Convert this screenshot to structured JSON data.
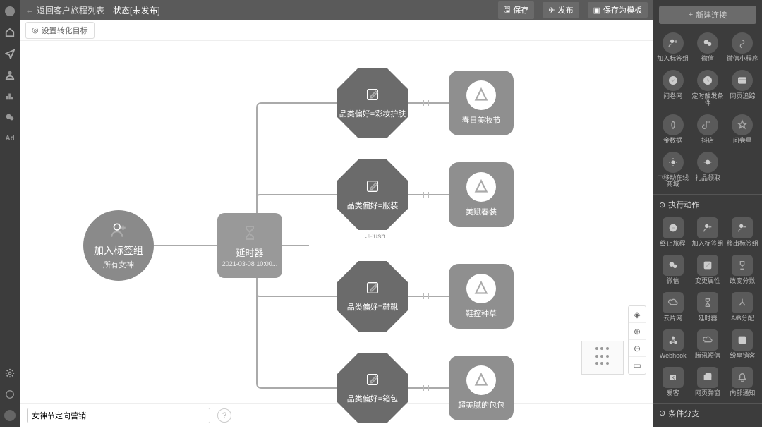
{
  "leftRail": [
    "home",
    "send",
    "user",
    "chart",
    "chat",
    "ad"
  ],
  "topbar": {
    "back": "返回客户旅程列表",
    "status": "状态[未发布]",
    "save": "保存",
    "publish": "发布",
    "saveTpl": "保存为模板"
  },
  "subbar": {
    "goal": "设置转化目标"
  },
  "canvas": {
    "start": {
      "title": "加入标签组",
      "sub": "所有女神"
    },
    "delay": {
      "title": "延时器",
      "sub": "2021-03-08 10:00..."
    },
    "branches": [
      {
        "cond": "品类偏好=彩妆护肤",
        "out": "春日美妆节"
      },
      {
        "cond": "品类偏好=服装",
        "out": "美赋春装",
        "caption": "JPush"
      },
      {
        "cond": "品类偏好=鞋靴",
        "out": "鞋控种草"
      },
      {
        "cond": "品类偏好=箱包",
        "out": "超美腻的包包"
      }
    ]
  },
  "bottom": {
    "name": "女神节定向营销"
  },
  "panel": {
    "newBtn": "新建连接",
    "row1": [
      {
        "l": "加入标签组"
      },
      {
        "l": "微信"
      },
      {
        "l": "微信小程序"
      }
    ],
    "row2": [
      {
        "l": "问卷网"
      },
      {
        "l": "定时触发条件"
      },
      {
        "l": "网页追踪"
      }
    ],
    "row3": [
      {
        "l": "金数据"
      },
      {
        "l": "抖店"
      },
      {
        "l": "问卷星"
      }
    ],
    "row4": [
      {
        "l": "中移动在线商城"
      },
      {
        "l": "礼品领取"
      }
    ],
    "sec2": "执行动作",
    "row5": [
      {
        "l": "终止旅程"
      },
      {
        "l": "加入标签组"
      },
      {
        "l": "移出标签组"
      }
    ],
    "row6": [
      {
        "l": "微信"
      },
      {
        "l": "变更属性"
      },
      {
        "l": "改变分数"
      }
    ],
    "row7": [
      {
        "l": "云片网"
      },
      {
        "l": "延时器"
      },
      {
        "l": "A/B分配"
      }
    ],
    "row8": [
      {
        "l": "Webhook"
      },
      {
        "l": "腾讯短信"
      },
      {
        "l": "纷享销客"
      }
    ],
    "row9": [
      {
        "l": "爱客"
      },
      {
        "l": "网页弹窗"
      },
      {
        "l": "内部通知"
      }
    ],
    "sec3": "条件分支"
  }
}
